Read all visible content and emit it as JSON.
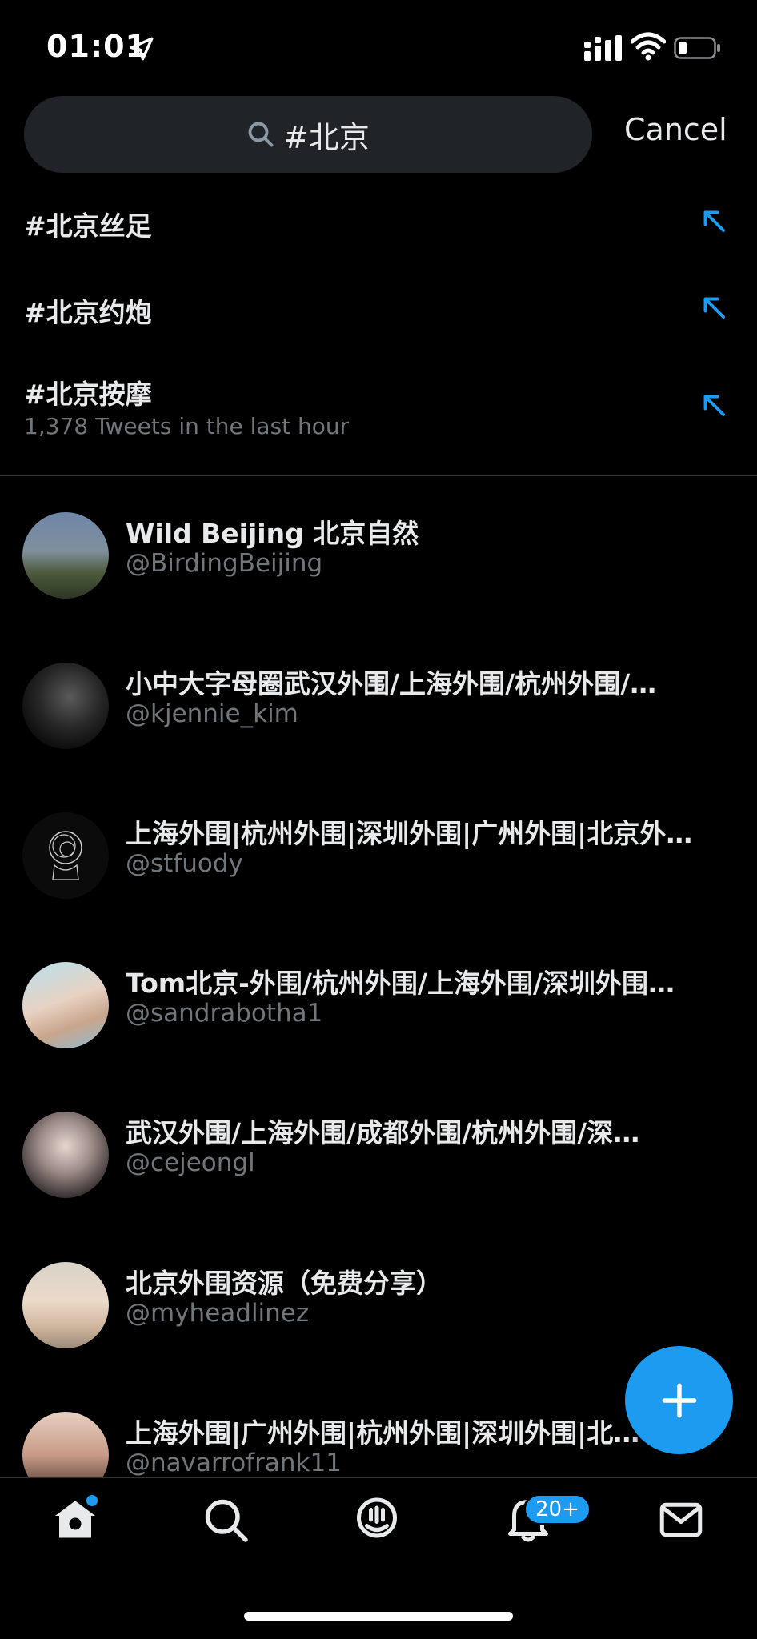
{
  "status_bar": {
    "time": "01:01"
  },
  "search": {
    "query": "#北京",
    "cancel_label": "Cancel"
  },
  "suggestions": [
    {
      "tag": "#北京丝足",
      "sub": ""
    },
    {
      "tag": "#北京约炮",
      "sub": ""
    },
    {
      "tag": "#北京按摩",
      "sub": "1,378 Tweets in the last hour"
    }
  ],
  "accounts": [
    {
      "name": "Wild Beijing 北京自然",
      "handle": "@BirdingBeijing"
    },
    {
      "name": "小中大字母圈武汉外围/上海外围/杭州外围/…",
      "handle": "@kjennie_kim"
    },
    {
      "name": "上海外围|杭州外围|深圳外围|广州外围|北京外…",
      "handle": "@stfuody"
    },
    {
      "name": "Tom北京-外围/杭州外围/上海外围/深圳外围…",
      "handle": "@sandrabotha1"
    },
    {
      "name": "武汉外围/上海外围/成都外围/杭州外围/深…",
      "handle": "@cejeongl"
    },
    {
      "name": "北京外围资源（免费分享）",
      "handle": "@myheadlinez"
    },
    {
      "name": "上海外围|广州外围|杭州外围|深圳外围|北…",
      "handle": "@navarrofrank11"
    }
  ],
  "tab_bar": {
    "notifications_badge": "20+",
    "icons": [
      "home-icon",
      "search-icon",
      "spaces-icon",
      "notifications-icon",
      "messages-icon"
    ]
  },
  "colors": {
    "accent": "#1d9bf0",
    "background": "#000000",
    "secondary_text": "#71767b"
  }
}
